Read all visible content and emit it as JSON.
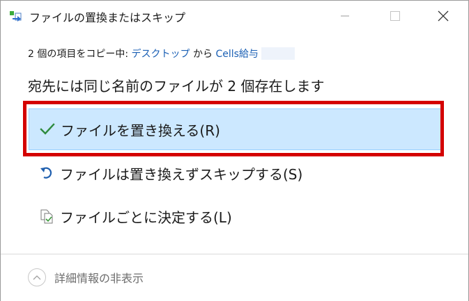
{
  "window": {
    "title": "ファイルの置換またはスキップ"
  },
  "copy_status": {
    "prefix": "2 個の項目をコピー中: ",
    "source": "デスクトップ",
    "connector": " から ",
    "destination": "Cells給与"
  },
  "heading": "宛先には同じ名前のファイルが 2 個存在します",
  "options": [
    {
      "label": "ファイルを置き換える(R)",
      "icon": "check-icon",
      "selected": true
    },
    {
      "label": "ファイルは置き換えずスキップする(S)",
      "icon": "skip-arrow-icon",
      "selected": false
    },
    {
      "label": "ファイルごとに決定する(L)",
      "icon": "compare-files-icon",
      "selected": false
    }
  ],
  "footer": {
    "details_label": "詳細情報の非表示",
    "icon": "chevron-up-icon"
  },
  "colors": {
    "selected_bg": "#cce8ff",
    "selected_border": "#99d1ff",
    "highlight_frame": "#d40000",
    "link": "#1a5fb4",
    "check": "#2e8b3e",
    "skip_arrow": "#1f5fae"
  }
}
